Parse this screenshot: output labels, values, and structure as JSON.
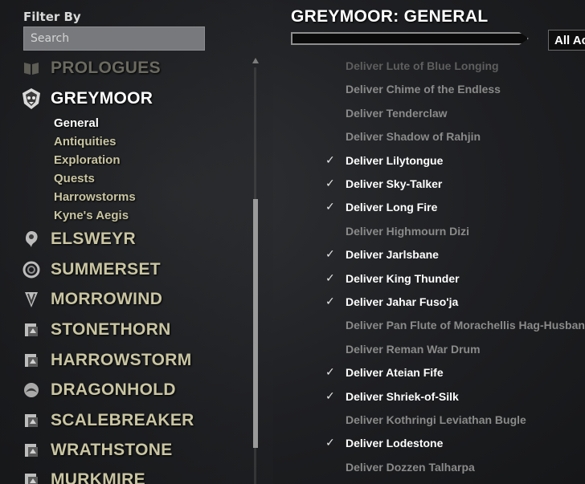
{
  "filter": {
    "label": "Filter By",
    "search_placeholder": "Search"
  },
  "categories": [
    {
      "label": "PROLOGUES",
      "icon": "book-icon",
      "dim": true
    },
    {
      "label": "GREYMOOR",
      "icon": "greymoor-emblem-icon",
      "selected": true
    },
    {
      "label": "ELSWEYR",
      "icon": "elsweyr-emblem-icon"
    },
    {
      "label": "SUMMERSET",
      "icon": "summerset-emblem-icon"
    },
    {
      "label": "MORROWIND",
      "icon": "morrowind-emblem-icon"
    },
    {
      "label": "STONETHORN",
      "icon": "dlc-pack-icon"
    },
    {
      "label": "HARROWSTORM",
      "icon": "dlc-pack-icon"
    },
    {
      "label": "DRAGONHOLD",
      "icon": "dragonhold-emblem-icon"
    },
    {
      "label": "SCALEBREAKER",
      "icon": "dlc-pack-icon"
    },
    {
      "label": "WRATHSTONE",
      "icon": "dlc-pack-icon"
    },
    {
      "label": "MURKMIRE",
      "icon": "dlc-pack-icon"
    }
  ],
  "subcategories": [
    {
      "label": "General",
      "selected": true
    },
    {
      "label": "Antiquities"
    },
    {
      "label": "Exploration"
    },
    {
      "label": "Quests"
    },
    {
      "label": "Harrowstorms"
    },
    {
      "label": "Kyne's Aegis"
    }
  ],
  "header": {
    "title": "GREYMOOR: GENERAL",
    "dropdown_selected": "All Achievements"
  },
  "progress": {
    "fraction": 0.0
  },
  "achievements": [
    {
      "label": "Deliver Lute of Blue Longing",
      "completed": false,
      "faded": true
    },
    {
      "label": "Deliver Chime of the Endless",
      "completed": false
    },
    {
      "label": "Deliver Tenderclaw",
      "completed": false
    },
    {
      "label": "Deliver Shadow of Rahjin",
      "completed": false
    },
    {
      "label": "Deliver Lilytongue",
      "completed": true
    },
    {
      "label": "Deliver Sky-Talker",
      "completed": true
    },
    {
      "label": "Deliver Long Fire",
      "completed": true
    },
    {
      "label": "Deliver Highmourn Dizi",
      "completed": false
    },
    {
      "label": "Deliver Jarlsbane",
      "completed": true
    },
    {
      "label": "Deliver King Thunder",
      "completed": true
    },
    {
      "label": "Deliver Jahar Fuso'ja",
      "completed": true
    },
    {
      "label": "Deliver Pan Flute of Morachellis Hag-Husband",
      "completed": false
    },
    {
      "label": "Deliver Reman War Drum",
      "completed": false
    },
    {
      "label": "Deliver Ateian Fife",
      "completed": true
    },
    {
      "label": "Deliver Shriek-of-Silk",
      "completed": true
    },
    {
      "label": "Deliver Kothringi Leviathan Bugle",
      "completed": false
    },
    {
      "label": "Deliver Lodestone",
      "completed": true
    },
    {
      "label": "Deliver Dozzen Talharpa",
      "completed": false
    }
  ],
  "check_glyph": "✓"
}
